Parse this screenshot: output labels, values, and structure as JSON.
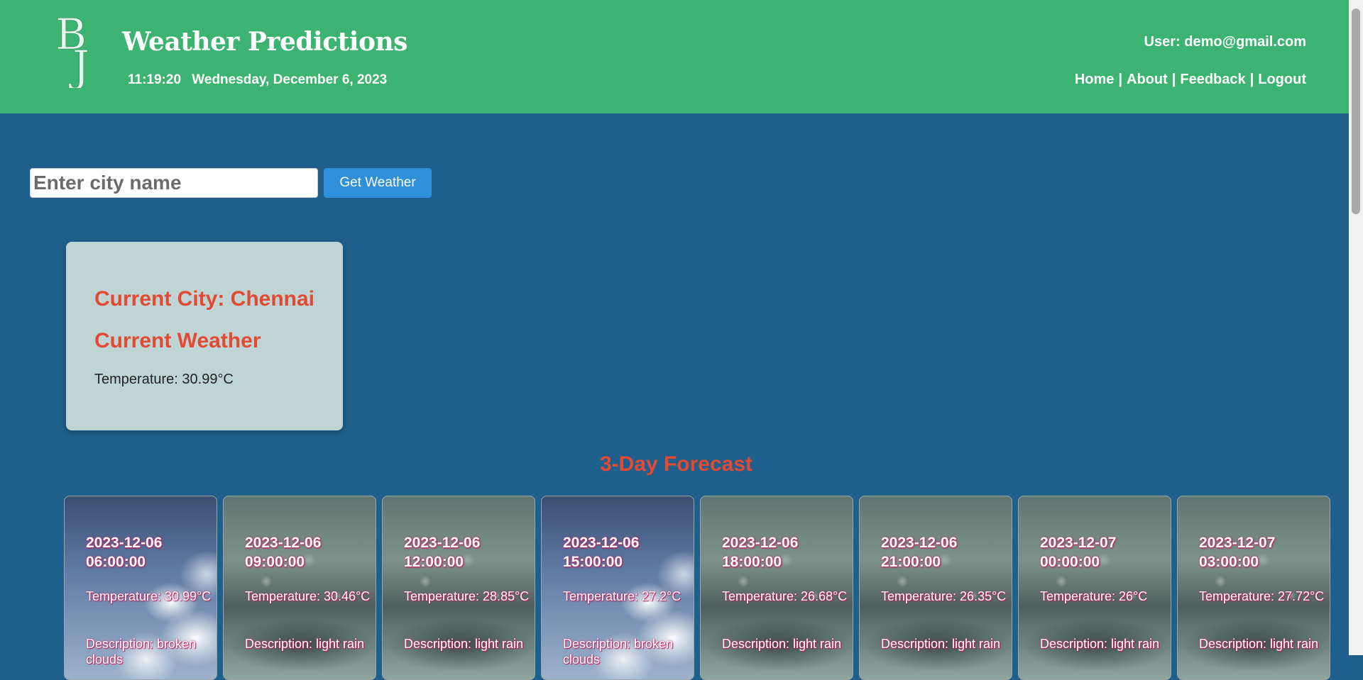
{
  "header": {
    "title": "Weather Predictions",
    "time": "11:19:20",
    "date": "Wednesday, December 6, 2023",
    "user_label": "User: demo@gmail.com",
    "nav": [
      {
        "label": "Home"
      },
      {
        "label": "About"
      },
      {
        "label": "Feedback"
      },
      {
        "label": "Logout"
      }
    ],
    "separator": "|",
    "logo_text": "BJ"
  },
  "search": {
    "placeholder": "Enter city name",
    "value": "",
    "button_label": "Get Weather"
  },
  "current": {
    "city_label": "Current City: Chennai",
    "heading": "Current Weather",
    "temperature": "Temperature: 30.99°C"
  },
  "forecast": {
    "heading": "3-Day Forecast",
    "items": [
      {
        "date": "2023-12-06",
        "time": "06:00:00",
        "temperature": "Temperature: 30.99°C",
        "description": "Description: broken clouds",
        "bg": "cloud"
      },
      {
        "date": "2023-12-06",
        "time": "09:00:00",
        "temperature": "Temperature: 30.46°C",
        "description": "Description: light rain",
        "bg": "rain"
      },
      {
        "date": "2023-12-06",
        "time": "12:00:00",
        "temperature": "Temperature: 28.85°C",
        "description": "Description: light rain",
        "bg": "rain"
      },
      {
        "date": "2023-12-06",
        "time": "15:00:00",
        "temperature": "Temperature: 27.2°C",
        "description": "Description: broken clouds",
        "bg": "cloud"
      },
      {
        "date": "2023-12-06",
        "time": "18:00:00",
        "temperature": "Temperature: 26.68°C",
        "description": "Description: light rain",
        "bg": "rain"
      },
      {
        "date": "2023-12-06",
        "time": "21:00:00",
        "temperature": "Temperature: 26.35°C",
        "description": "Description: light rain",
        "bg": "rain"
      },
      {
        "date": "2023-12-07",
        "time": "00:00:00",
        "temperature": "Temperature: 26°C",
        "description": "Description: light rain",
        "bg": "rain"
      },
      {
        "date": "2023-12-07",
        "time": "03:00:00",
        "temperature": "Temperature: 27.72°C",
        "description": "Description: light rain",
        "bg": "rain"
      }
    ]
  },
  "colors": {
    "header_bg": "#3cb371",
    "page_bg": "#1f5f8b",
    "accent_red": "#e34a33",
    "button_blue": "#2f8fd8",
    "card_bg": "#bfd4d4"
  }
}
